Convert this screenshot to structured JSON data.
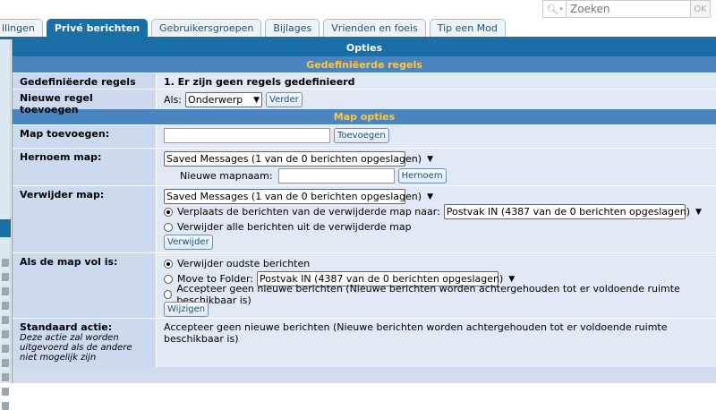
{
  "search": {
    "placeholder": "Zoeken",
    "ok_label": "OK"
  },
  "tabs": [
    {
      "label": "llingen"
    },
    {
      "label": "Privé berichten"
    },
    {
      "label": "Gebruikersgroepen"
    },
    {
      "label": "Bijlages"
    },
    {
      "label": "Vrienden en foeis"
    },
    {
      "label": "Tip een Mod"
    }
  ],
  "options": {
    "header": "Opties",
    "rules_header": "Gedefiniëerde regels",
    "rules_label": "Gedefiniëerde regels",
    "rules_value": "1.   Er zijn geen regels gedefinieerd",
    "new_rule_label": "Nieuwe regel toevoegen",
    "new_rule_prefix": "Als:",
    "new_rule_select": "Onderwerp",
    "new_rule_button": "Verder"
  },
  "map_options": {
    "header": "Map opties",
    "add_label": "Map toevoegen:",
    "add_button": "Toevoegen",
    "rename_label": "Hernoem map:",
    "rename_select": "Saved Messages (1 van de 0 berichten opgeslagen)",
    "rename_new_label": "Nieuwe mapnaam:",
    "rename_button": "Hernoem",
    "delete_label": "Verwijder map:",
    "delete_select": "Saved Messages (1 van de 0 berichten opgeslagen)",
    "delete_move_label": "Verplaats de berichten van de verwijderde map naar:",
    "delete_move_select": "Postvak IN (4387 van de 0 berichten opgeslagen)",
    "delete_all_label": "Verwijder alle berichten uit de verwijderde map",
    "delete_button": "Verwijder",
    "full_label": "Als de map vol is:",
    "full_opt1": "Verwijder oudste berichten",
    "full_opt2": "Move to Folder:",
    "full_opt2_select": "Postvak IN (4387 van de 0 berichten opgeslagen)",
    "full_opt3": "Accepteer geen nieuwe berichten (Nieuwe berichten worden achtergehouden tot er voldoende ruimte beschikbaar is)",
    "full_button": "Wijzigen",
    "default_label": "Standaard actie:",
    "default_sub": "Deze actie zal worden uitgevoerd als de andere niet mogelijk zijn",
    "default_value": "Accepteer geen nieuwe berichten (Nieuwe berichten worden achtergehouden tot er voldoende ruimte beschikbaar is)"
  },
  "icons": {
    "search": "search-icon",
    "dropdown": "chevron-down-icon"
  }
}
